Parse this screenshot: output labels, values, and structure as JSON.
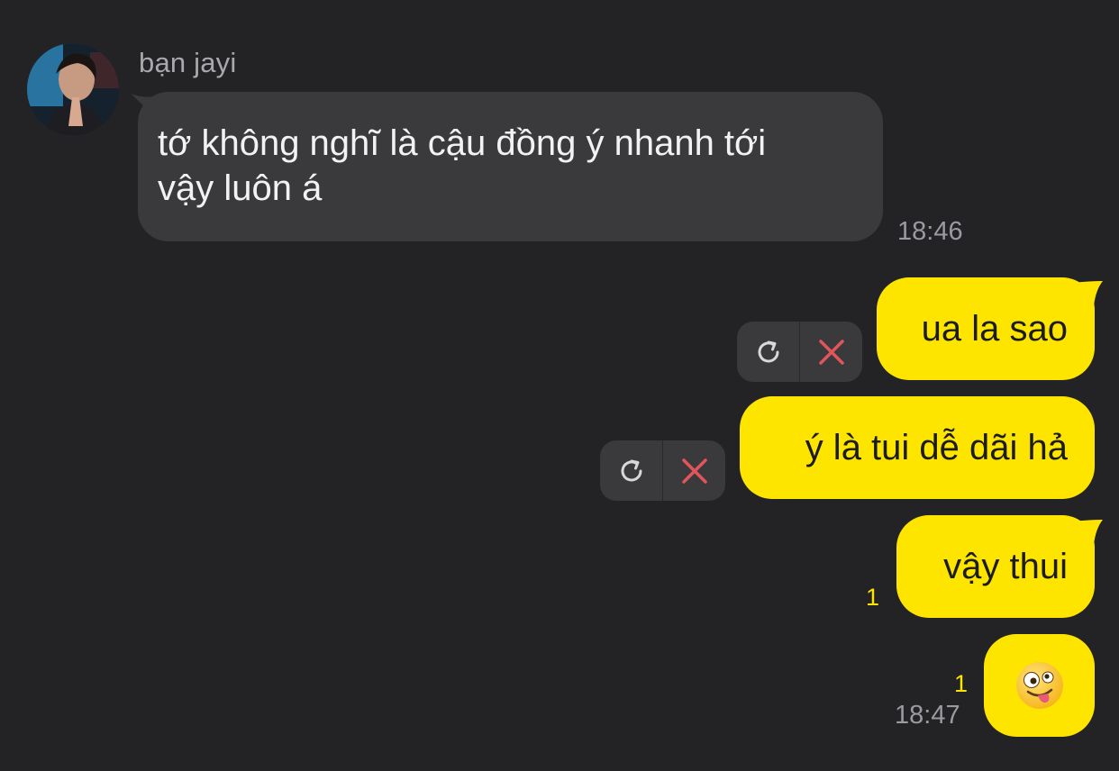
{
  "colors": {
    "background": "#232325",
    "incoming_bubble": "#3a3a3d",
    "outgoing_bubble": "#fee500",
    "unread_count": "#fee500",
    "delete_icon": "#e2555a"
  },
  "incoming": {
    "sender_name": "bạn jayi",
    "message_line1": "tớ không nghĩ là cậu đồng ý nhanh tới",
    "message_line2": "vậy luôn á",
    "time": "18:46"
  },
  "outgoing": [
    {
      "text": "ua la sao",
      "status": "failed"
    },
    {
      "text": "ý là tui dễ dãi hả",
      "status": "failed"
    },
    {
      "text": "vậy thui",
      "unread": "1"
    },
    {
      "emoji": "zany-face-icon",
      "unread": "1",
      "time": "18:47"
    }
  ],
  "icons": {
    "resend": "refresh-icon",
    "delete": "close-icon"
  }
}
